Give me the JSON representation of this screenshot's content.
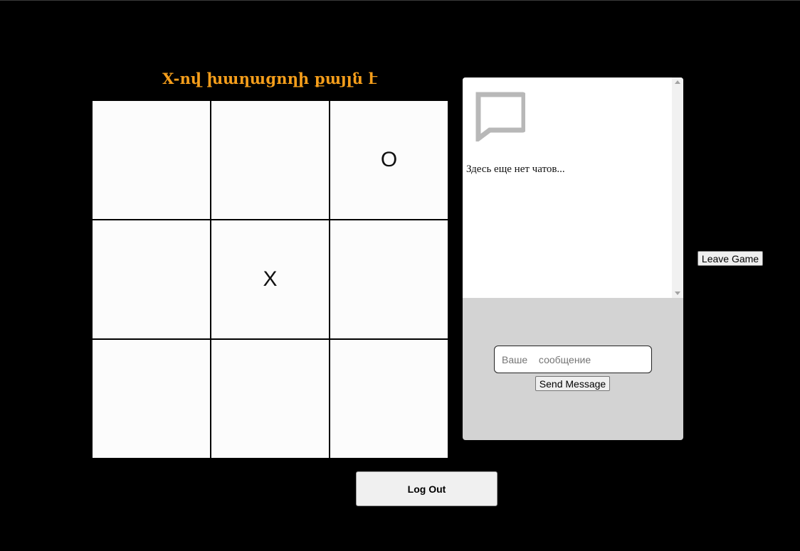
{
  "game": {
    "turn_text": "X-ով խաղացողի քայլն է",
    "board": [
      [
        "",
        "",
        "O"
      ],
      [
        "",
        "X",
        ""
      ],
      [
        "",
        "",
        ""
      ]
    ]
  },
  "chat": {
    "empty_text": "Здесь еще нет чатов...",
    "input_placeholder": "Ваше  сообщение",
    "input_value": "",
    "send_label": "Send Message",
    "icon": "chat-bubble-icon"
  },
  "actions": {
    "leave_label": "Leave Game",
    "logout_label": "Log Out"
  },
  "colors": {
    "background": "#000000",
    "title": "#f59e1b",
    "cell": "#fcfcfc",
    "chat_footer": "#d3d3d3",
    "chat_icon": "#b8b8b8"
  }
}
